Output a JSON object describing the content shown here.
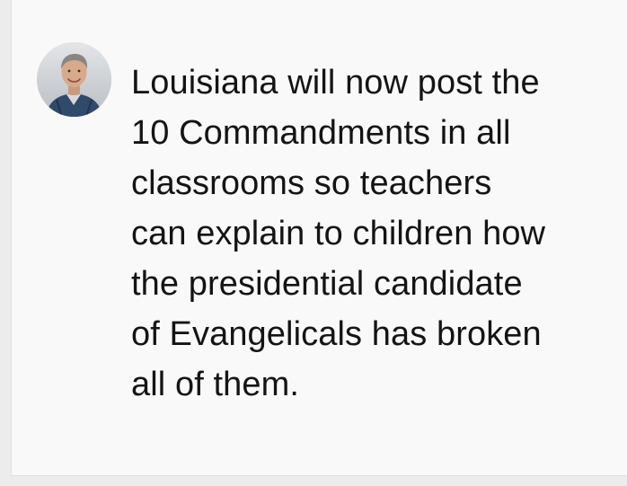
{
  "post": {
    "avatar_icon": "person-avatar",
    "text_lines": [
      "Louisiana will now post the",
      "10 Commandments in all",
      "classrooms so teachers",
      "can explain to children how",
      "the presidential candidate",
      "of Evangelicals has broken",
      "all of them."
    ]
  },
  "colors": {
    "card_background": "#f9f9f9",
    "page_background": "#ececec",
    "text": "#141414"
  }
}
